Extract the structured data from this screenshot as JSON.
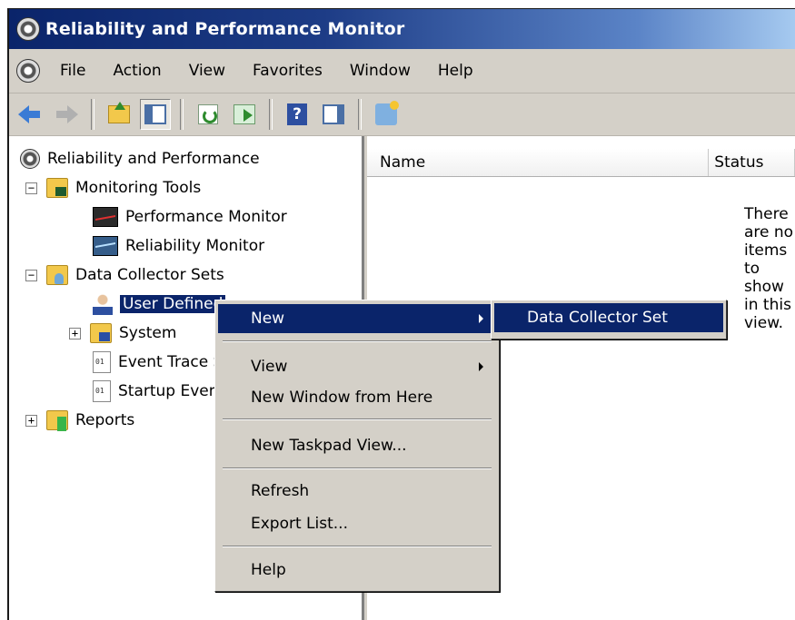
{
  "window": {
    "title": "Reliability and Performance Monitor"
  },
  "menubar": {
    "items": [
      "File",
      "Action",
      "View",
      "Favorites",
      "Window",
      "Help"
    ]
  },
  "toolbar": {
    "buttons": [
      "back-icon",
      "forward-icon",
      "up-folder-icon",
      "show-hide-tree-icon",
      "refresh-icon",
      "export-list-icon",
      "help-icon",
      "properties-icon",
      "new-window-icon"
    ],
    "help_glyph": "?"
  },
  "tree": {
    "root": "Reliability and Performance",
    "monitoring_tools": "Monitoring Tools",
    "performance_monitor": "Performance Monitor",
    "reliability_monitor": "Reliability Monitor",
    "data_collector_sets": "Data Collector Sets",
    "user_defined": "User Defined",
    "system": "System",
    "event_trace": "Event Trace Sessions",
    "startup_event": "Startup Event Trace Sessions",
    "reports": "Reports",
    "expanded_glyph": "−",
    "collapsed_glyph": "+"
  },
  "list": {
    "columns": [
      "Name",
      "Status"
    ],
    "empty_text": "There are no items to show in this view."
  },
  "context_menu": {
    "new": "New",
    "view": "View",
    "new_window": "New Window from Here",
    "new_taskpad": "New Taskpad View...",
    "refresh": "Refresh",
    "export_list": "Export List...",
    "help": "Help"
  },
  "submenu": {
    "data_collector_set": "Data Collector Set"
  },
  "colors": {
    "selection": "#0a246a",
    "face": "#d4d0c8",
    "title_start": "#0a246a",
    "title_end": "#a6caf0"
  }
}
